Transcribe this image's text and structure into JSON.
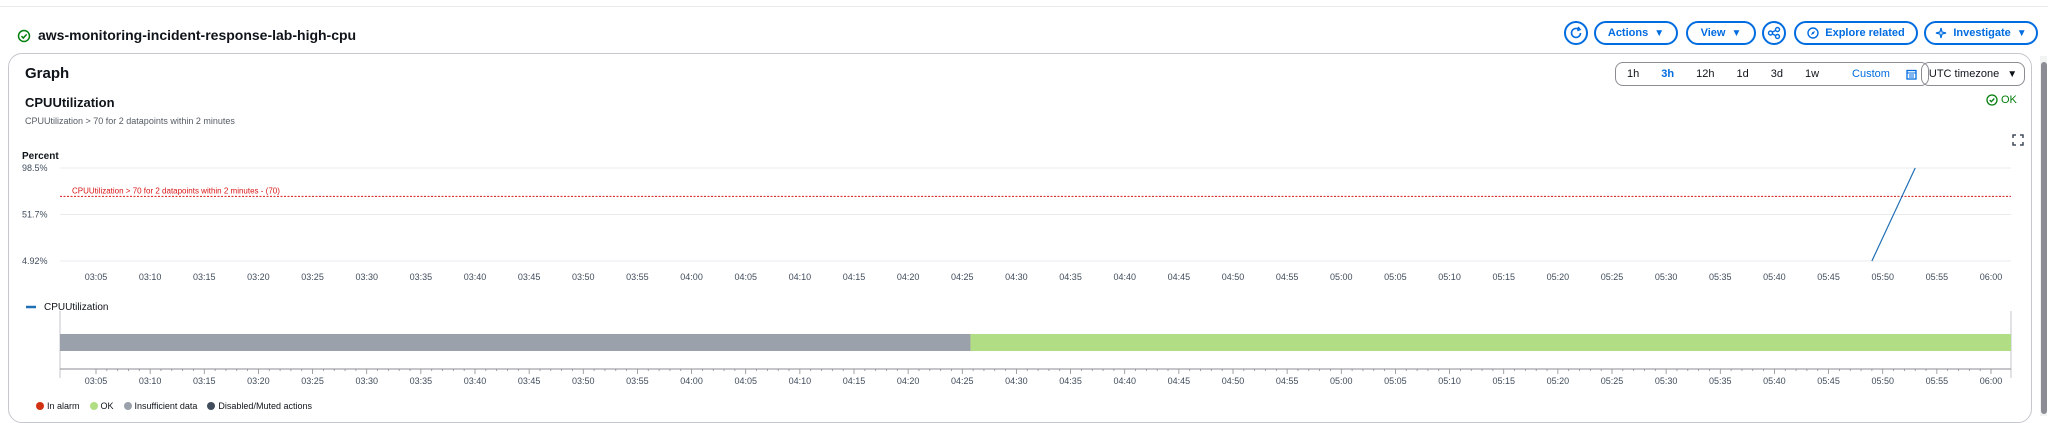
{
  "alarm": {
    "name": "aws-monitoring-incident-response-lab-high-cpu",
    "header_buttons": {
      "actions": "Actions",
      "view": "View",
      "explore": "Explore related",
      "investigate": "Investigate"
    }
  },
  "graph": {
    "title": "Graph",
    "time_ranges": [
      "1h",
      "3h",
      "12h",
      "1d",
      "3d",
      "1w"
    ],
    "active_range": "3h",
    "custom_label": "Custom",
    "timezone": "UTC timezone",
    "metric_title": "CPUUtilization",
    "metric_subtitle": "CPUUtilization > 70 for 2 datapoints within 2 minutes",
    "state": "OK",
    "expand_icon": "expand-icon"
  },
  "chart_data": [
    {
      "type": "line",
      "ylabel": "Percent",
      "y_ticks": [
        "98.5%",
        "51.7%",
        "4.92%"
      ],
      "ylim": [
        4.92,
        98.5
      ],
      "x_ticks": [
        "03:05",
        "03:10",
        "03:15",
        "03:20",
        "03:25",
        "03:30",
        "03:35",
        "03:40",
        "03:45",
        "03:50",
        "03:55",
        "04:00",
        "04:05",
        "04:10",
        "04:15",
        "04:20",
        "04:25",
        "04:30",
        "04:35",
        "04:40",
        "04:45",
        "04:50",
        "04:55",
        "05:00",
        "05:05",
        "05:10",
        "05:15",
        "05:20",
        "05:25",
        "05:30",
        "05:35",
        "05:40",
        "05:45",
        "05:50",
        "05:55",
        "06:00"
      ],
      "threshold": {
        "value": 70,
        "label": "CPUUtilization > 70 for 2 datapoints within 2 minutes - (70)",
        "color": "#d91515"
      },
      "series": [
        {
          "name": "CPUUtilization",
          "color": "#1f6fb5",
          "points": [
            {
              "x": "05:49",
              "y": 4.92
            },
            {
              "x": "05:53",
              "y": 98.5
            }
          ]
        }
      ],
      "legend": [
        "CPUUtilization"
      ]
    },
    {
      "type": "bar",
      "title": "",
      "x_ticks": [
        "03:05",
        "03:10",
        "03:15",
        "03:20",
        "03:25",
        "03:30",
        "03:35",
        "03:40",
        "03:45",
        "03:50",
        "03:55",
        "04:00",
        "04:05",
        "04:10",
        "04:15",
        "04:20",
        "04:25",
        "04:30",
        "04:35",
        "04:40",
        "04:45",
        "04:50",
        "04:55",
        "05:00",
        "05:05",
        "05:10",
        "05:15",
        "05:20",
        "05:25",
        "05:30",
        "05:35",
        "05:40",
        "05:45",
        "05:50",
        "05:55",
        "06:00"
      ],
      "segments": [
        {
          "state": "Insufficient data",
          "start": "03:02",
          "end": "04:26",
          "color": "#9ba1ab"
        },
        {
          "state": "OK",
          "start": "04:26",
          "end": "06:02",
          "color": "#b1dd84"
        }
      ],
      "legend": [
        {
          "label": "In alarm",
          "color": "#d13212"
        },
        {
          "label": "OK",
          "color": "#b1dd84"
        },
        {
          "label": "Insufficient data",
          "color": "#9ba1ab"
        },
        {
          "label": "Disabled/Muted actions",
          "color": "#414d5c"
        }
      ]
    }
  ]
}
